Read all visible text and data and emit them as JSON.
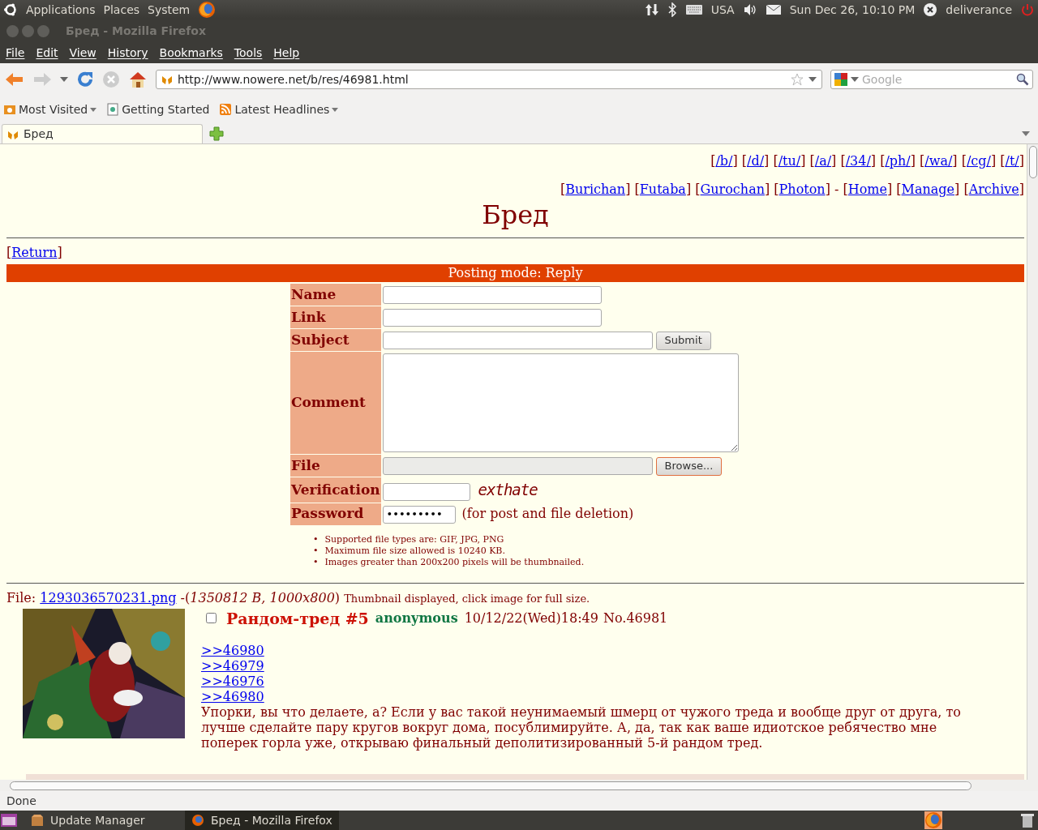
{
  "top_panel": {
    "menus": [
      "Applications",
      "Places",
      "System"
    ],
    "keyboard_layout": "USA",
    "clock": "Sun Dec 26, 10:10 PM",
    "user": "deliverance"
  },
  "window": {
    "title": "Бред - Mozilla Firefox"
  },
  "menu_bar": [
    "File",
    "Edit",
    "View",
    "History",
    "Bookmarks",
    "Tools",
    "Help"
  ],
  "address_bar": {
    "value": "http://www.nowere.net/b/res/46981.html"
  },
  "search_bar": {
    "placeholder": "Google"
  },
  "bookmarks": [
    {
      "label": "Most Visited",
      "kind": "folder"
    },
    {
      "label": "Getting Started",
      "kind": "page"
    },
    {
      "label": "Latest Headlines",
      "kind": "feed"
    }
  ],
  "tabs": [
    {
      "label": "Бред",
      "selected": true
    }
  ],
  "page": {
    "brackets": [
      "[",
      "]"
    ],
    "board_links": [
      {
        "kind": "link",
        "label": "/b/"
      },
      {
        "kind": "link",
        "label": "/d/"
      },
      {
        "kind": "link",
        "label": "/tu/"
      },
      {
        "kind": "link",
        "label": "/a/"
      },
      {
        "kind": "link",
        "label": "/34/"
      },
      {
        "kind": "link",
        "label": "/ph/"
      },
      {
        "kind": "link",
        "label": "/wa/"
      },
      {
        "kind": "link",
        "label": "/cg/"
      },
      {
        "kind": "link",
        "label": "/t/"
      }
    ],
    "site_links": [
      {
        "kind": "link",
        "label": "Burichan"
      },
      {
        "kind": "link",
        "label": "Futaba"
      },
      {
        "kind": "link",
        "label": "Gurochan"
      },
      {
        "kind": "link",
        "label": "Photon"
      },
      {
        "kind": "separator",
        "label": "-"
      },
      {
        "kind": "link",
        "label": "Home"
      },
      {
        "kind": "link",
        "label": "Manage"
      },
      {
        "kind": "link",
        "label": "Archive"
      }
    ],
    "title": "Бред",
    "return_link": "Return",
    "posting_mode": "Posting mode: Reply",
    "form": [
      {
        "label": "Name",
        "kind": "text"
      },
      {
        "label": "Link",
        "kind": "text"
      },
      {
        "label": "Subject",
        "kind": "text",
        "button": "Submit"
      },
      {
        "label": "Comment",
        "kind": "textarea"
      },
      {
        "label": "File",
        "kind": "file",
        "button": "Browse..."
      },
      {
        "label": "Verification",
        "kind": "captcha",
        "captcha": "exthate"
      },
      {
        "label": "Password",
        "kind": "password",
        "value": "•••••••••",
        "note": "(for post and file deletion)"
      }
    ],
    "rule_marker": "•",
    "rules": [
      "Supported file types are: GIF, JPG, PNG",
      "Maximum file size allowed is 10240 KB.",
      "Images greater than 200x200 pixels will be thumbnailed."
    ],
    "post": {
      "file_label": "File:",
      "file_name": "1293036570231.png",
      "file_info": "-(*1350812 B, 1000x800*)",
      "thumb_note": "Thumbnail displayed, click image for full size.",
      "checked": false,
      "subject": "Рандом-тред #5",
      "author": "anonymous",
      "date": "10/12/22(Wed)18:49",
      "number": "No.46981",
      "replies": [
        ">>46980",
        ">>46979",
        ">>46976",
        ">>46980"
      ],
      "message": "Упорки, вы что делаете, а? Если у вас такой неунимаемый шмерц от чужого треда и вообще друг от друга, то лучше сделайте пару кругов вокруг дома, посублимируйте. А, да, так как ваше идиотское ребячество мне поперек горла уже, открываю финальный деполитизированный 5-й рандом тред."
    }
  },
  "status_bar": "Done",
  "taskbar": [
    {
      "label": "Update Manager",
      "selected": false
    },
    {
      "label": "Бред - Mozilla Firefox",
      "selected": true
    }
  ]
}
